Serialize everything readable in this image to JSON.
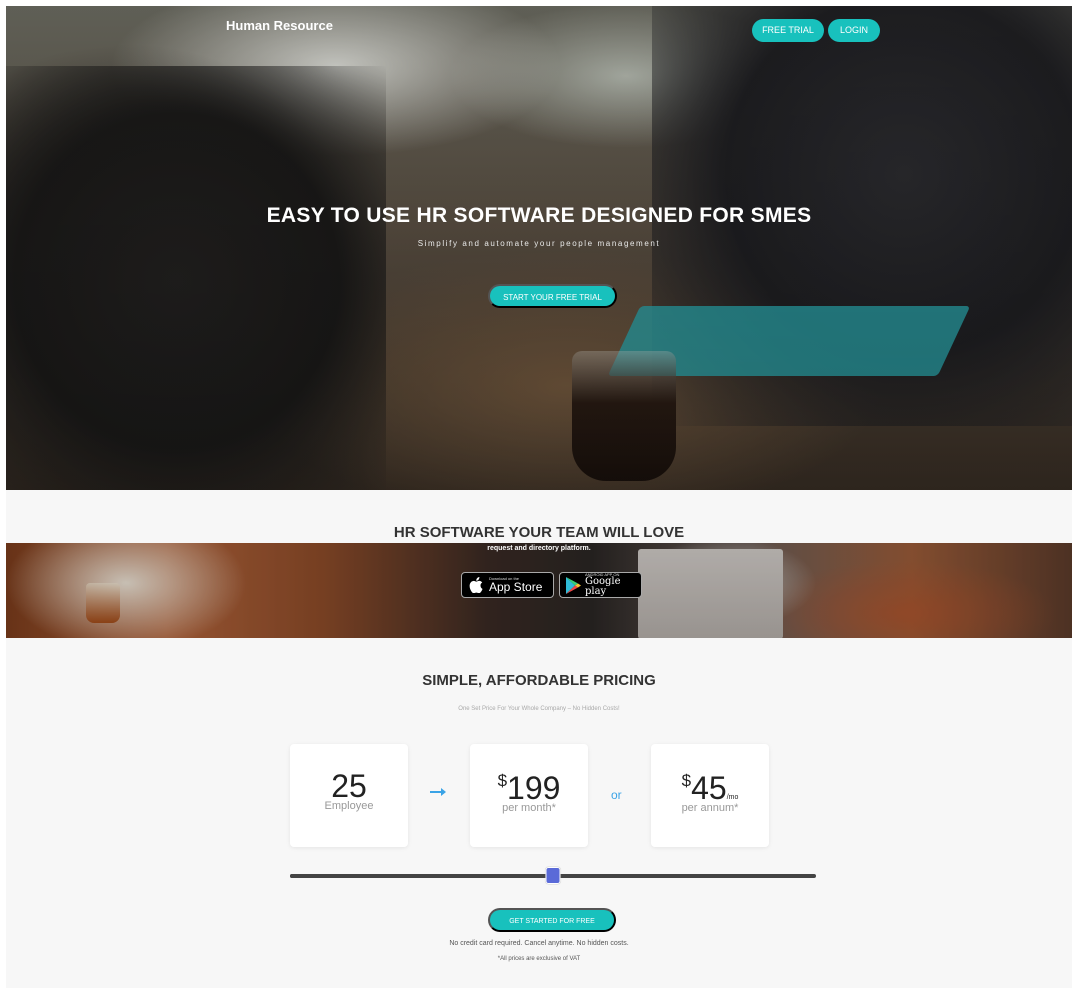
{
  "header": {
    "brand": "Human Resource",
    "free_trial_label": "FREE TRIAL",
    "login_label": "LOGIN"
  },
  "hero": {
    "title": "EASY TO USE HR SOFTWARE DESIGNED FOR SMES",
    "subtitle": "Simplify and automate your people management",
    "cta_label": "START YOUR FREE TRIAL"
  },
  "team": {
    "title": "HR SOFTWARE YOUR TEAM WILL LOVE",
    "band_text": "request and directory platform.",
    "app_store": {
      "small": "Download on the",
      "big": "App Store"
    },
    "google_play": {
      "small": "ANDROID APP ON",
      "big": "Google play"
    }
  },
  "pricing": {
    "title": "SIMPLE, AFFORDABLE PRICING",
    "subtitle": "One Set Price For Your Whole Company – No Hidden Costs!",
    "employees": {
      "value": "25",
      "label": "Employee"
    },
    "monthly": {
      "currency": "$",
      "value": "199",
      "label": "per month*"
    },
    "or_label": "or",
    "annual": {
      "currency": "$",
      "value": "45",
      "suffix": "/mo",
      "label": "per annum*"
    },
    "slider_fraction": 0.5,
    "cta_label": "GET STARTED FOR FREE",
    "note": "No credit card required. Cancel anytime. No hidden costs.",
    "vat_note": "*All prices are exclusive of VAT"
  },
  "colors": {
    "accent": "#18c1bd",
    "link_blue": "#3aa3e6",
    "slider_thumb": "#5a6ad8"
  },
  "icons": [
    "apple-icon",
    "google-play-icon",
    "arrow-right-icon"
  ]
}
